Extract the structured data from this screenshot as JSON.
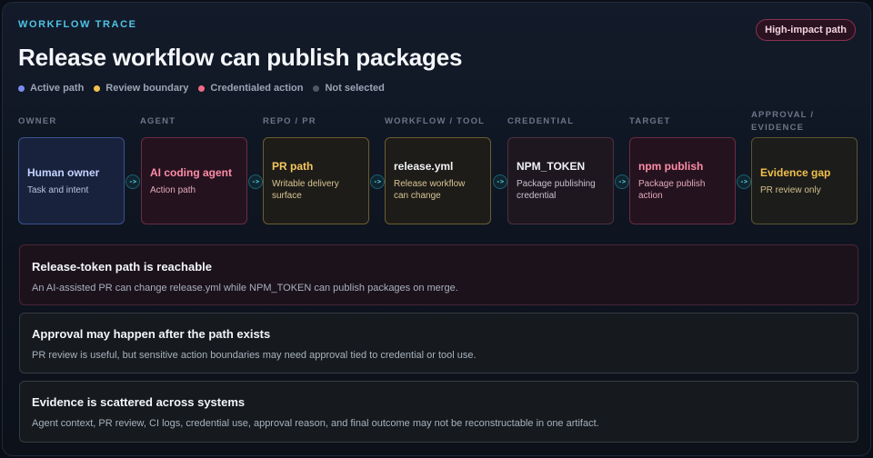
{
  "header": {
    "eyebrow": "WORKFLOW TRACE",
    "title": "Release workflow can publish packages",
    "badge": "High-impact path"
  },
  "legend": [
    {
      "label": "Active path",
      "color": "#7b8cf0"
    },
    {
      "label": "Review boundary",
      "color": "#f2c14e"
    },
    {
      "label": "Credentialed action",
      "color": "#f06b86"
    },
    {
      "label": "Not selected",
      "color": "#4e5766"
    }
  ],
  "columns": [
    {
      "label": "OWNER"
    },
    {
      "label": "AGENT"
    },
    {
      "label": "REPO / PR"
    },
    {
      "label": "WORKFLOW / TOOL"
    },
    {
      "label": "CREDENTIAL"
    },
    {
      "label": "TARGET"
    },
    {
      "label": "APPROVAL / EVIDENCE"
    }
  ],
  "nodes": [
    {
      "title": "Human owner",
      "subtitle": "Task and intent"
    },
    {
      "title": "AI coding agent",
      "subtitle": "Action path"
    },
    {
      "title": "PR path",
      "subtitle": "Writable delivery surface"
    },
    {
      "title": "release.yml",
      "subtitle": "Release workflow can change"
    },
    {
      "title": "NPM_TOKEN",
      "subtitle": "Package publishing credential"
    },
    {
      "title": "npm publish",
      "subtitle": "Package publish action"
    },
    {
      "title": "Evidence gap",
      "subtitle": "PR review only"
    }
  ],
  "arrow_glyph": "->",
  "findings": [
    {
      "title": "Release-token path is reachable",
      "body": "An AI-assisted PR can change release.yml while NPM_TOKEN can publish packages on merge."
    },
    {
      "title": "Approval may happen after the path exists",
      "body": "PR review is useful, but sensitive action boundaries may need approval tied to credential or tool use."
    },
    {
      "title": "Evidence is scattered across systems",
      "body": "Agent context, PR review, CI logs, credential use, approval reason, and final outcome may not be reconstructable in one artifact."
    }
  ]
}
